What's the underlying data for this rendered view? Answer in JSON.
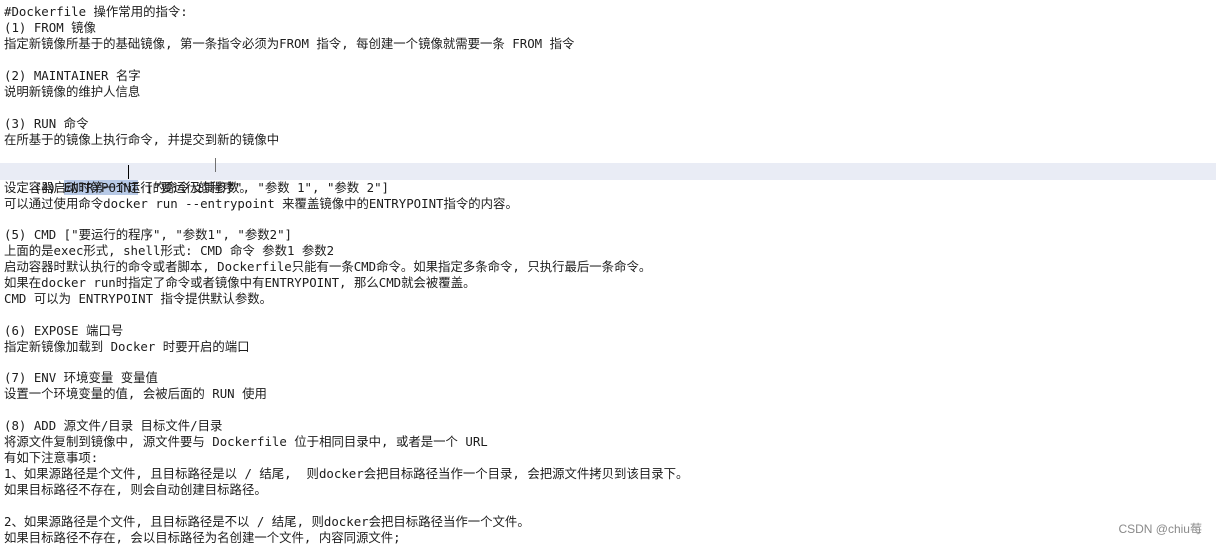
{
  "document": {
    "lines": [
      "#Dockerfile 操作常用的指令:",
      "(1) FROM 镜像",
      "指定新镜像所基于的基础镜像, 第一条指令必须为FROM 指令, 每创建一个镜像就需要一条 FROM 指令",
      "",
      "(2) MAINTAINER 名字",
      "说明新镜像的维护人信息",
      "",
      "(3) RUN 命令",
      "在所基于的镜像上执行命令, 并提交到新的镜像中",
      "",
      "",
      "设定容器启动时第一个运行的命令及其参数。",
      "可以通过使用命令docker run --entrypoint 来覆盖镜像中的ENTRYPOINT指令的内容。",
      "",
      "(5) CMD [\"要运行的程序\", \"参数1\", \"参数2\"]",
      "上面的是exec形式, shell形式: CMD 命令 参数1 参数2",
      "启动容器时默认执行的命令或者脚本, Dockerfile只能有一条CMD命令。如果指定多条命令, 只执行最后一条命令。",
      "如果在docker run时指定了命令或者镜像中有ENTRYPOINT, 那么CMD就会被覆盖。",
      "CMD 可以为 ENTRYPOINT 指令提供默认参数。",
      "",
      "(6) EXPOSE 端口号",
      "指定新镜像加载到 Docker 时要开启的端口",
      "",
      "(7) ENV 环境变量 变量值",
      "设置一个环境变量的值, 会被后面的 RUN 使用",
      "",
      "(8) ADD 源文件/目录 目标文件/目录",
      "将源文件复制到镜像中, 源文件要与 Dockerfile 位于相同目录中, 或者是一个 URL",
      "有如下注意事项:",
      "1、如果源路径是个文件, 且目标路径是以 / 结尾,  则docker会把目标路径当作一个目录, 会把源文件拷贝到该目录下。",
      "如果目标路径不存在, 则会自动创建目标路径。",
      "",
      "2、如果源路径是个文件, 且目标路径是不以 / 结尾, 则docker会把目标路径当作一个文件。",
      "如果目标路径不存在, 会以目标路径为名创建一个文件, 内容同源文件;"
    ],
    "highlighted_line": {
      "prefix": "(4) ",
      "selected": "ENTRYPOINT",
      "suffix": " [\"要运行的程序\", \"参数 1\", \"参数 2\"]"
    }
  },
  "watermark": "CSDN @chiu莓"
}
